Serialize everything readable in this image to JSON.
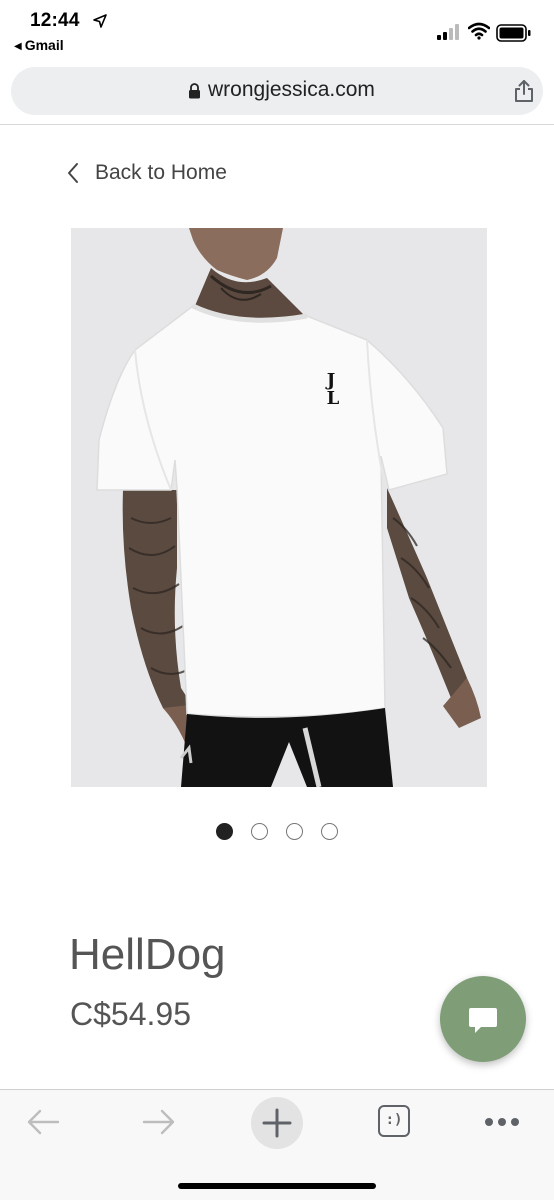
{
  "status_bar": {
    "time": "12:44",
    "back_app": "Gmail",
    "icons": [
      "location-arrow-icon",
      "cellular-signal-icon",
      "wifi-icon",
      "battery-icon"
    ]
  },
  "address_bar": {
    "url": "wrongjessica.com",
    "icons": [
      "lock-icon",
      "share-icon"
    ]
  },
  "page": {
    "back_link": "Back to Home",
    "product": {
      "name": "HellDog",
      "price": "C$54.95",
      "shirt_logo": "JL"
    },
    "carousel": {
      "image_count": 4,
      "active_index": 0
    }
  },
  "toolbar": {
    "icons": [
      "back-arrow-icon",
      "forward-arrow-icon",
      "new-tab-icon",
      "tabs-icon",
      "more-icon"
    ],
    "tabs_label": ":)"
  },
  "colors": {
    "chat_fab": "#7f9e78",
    "text": "#555555",
    "address_bar": "#eceef0",
    "image_background": "#e7e7e9"
  }
}
